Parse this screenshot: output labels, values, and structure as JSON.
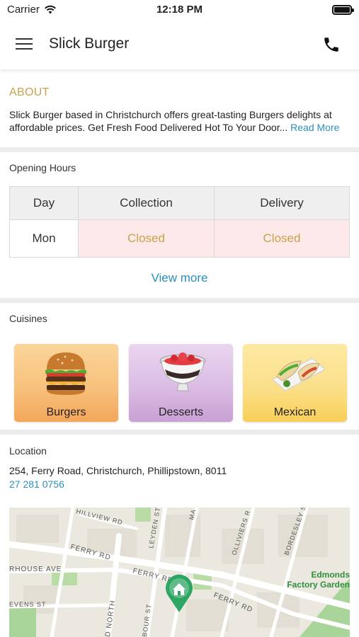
{
  "status_bar": {
    "carrier": "Carrier",
    "time": "12:18 PM",
    "icons": [
      "wifi-icon",
      "battery-icon"
    ]
  },
  "header": {
    "title": "Slick Burger",
    "menu_icon": "hamburger-menu-icon",
    "call_icon": "phone-icon"
  },
  "about": {
    "title": "ABOUT",
    "text_line1": "Slick Burger based in Christchurch offers great-tasting Burgers delights at",
    "text_line2": "affordable prices. Get Fresh Food Delivered Hot To Your Door...",
    "read_more": "Read More"
  },
  "opening_hours": {
    "title": "Opening Hours",
    "columns": [
      "Day",
      "Collection",
      "Delivery"
    ],
    "rows": [
      {
        "day": "Mon",
        "collection": "Closed",
        "delivery": "Closed"
      }
    ],
    "view_more": "View more"
  },
  "cuisines": {
    "title": "Cuisines",
    "items": [
      {
        "name": "Burgers",
        "icon": "burger-icon"
      },
      {
        "name": "Desserts",
        "icon": "dessert-bowl-icon"
      },
      {
        "name": "Mexican",
        "icon": "taco-icon"
      }
    ]
  },
  "location": {
    "title": "Location",
    "address": "254, Ferry Road, Christchurch, Phillipstown, 8011",
    "phone": "27 281 0756"
  },
  "map": {
    "labels": {
      "hillview": "HILLVIEW RD",
      "ferry1": "FERRY RD",
      "ferry2": "FERRY RD",
      "ferry3": "FERRY RD",
      "house_ave": "RHOUSE AVE",
      "leyden": "LEYDEN ST",
      "olliviers": "OLLIVIERS R",
      "bordesley": "BORDESLEY S",
      "evens": "EVENS ST",
      "north": "D NORTH",
      "bour": "BOUR ST",
      "ma": "MA",
      "park1": "Edmonds",
      "park2": "Factory Garden"
    },
    "marker_icon": "home-map-pin-icon"
  },
  "colors": {
    "accent_gold": "#c8a24a",
    "link_blue": "#2a8fbf",
    "closed_bg": "#fde9ea"
  }
}
